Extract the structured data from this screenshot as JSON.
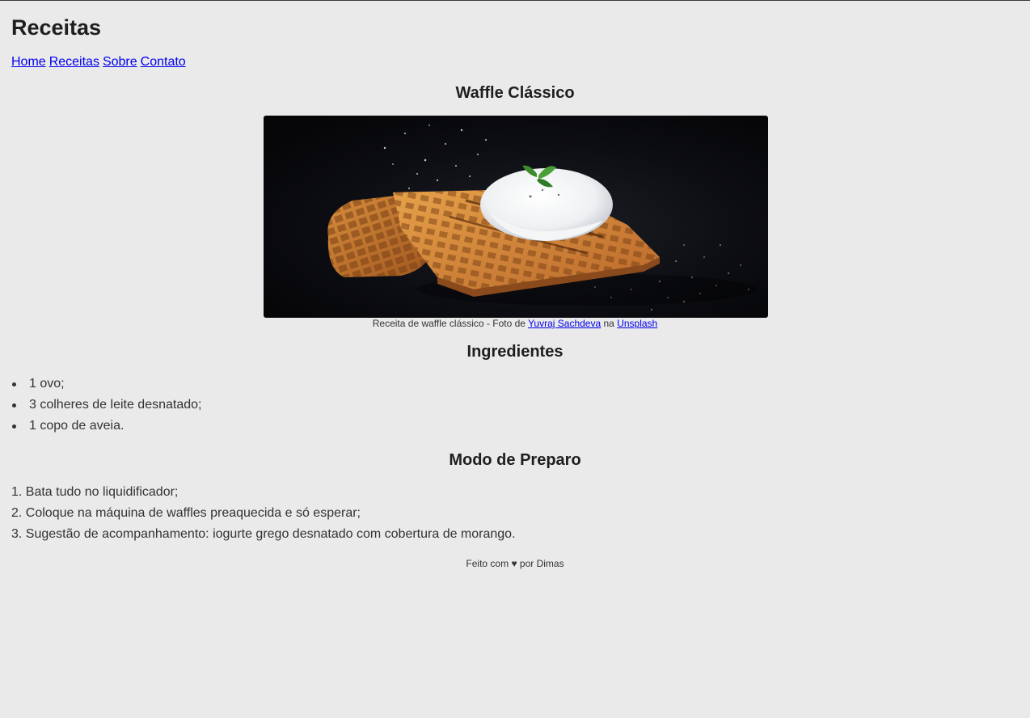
{
  "header": {
    "title": "Receitas",
    "nav": [
      "Home",
      "Receitas",
      "Sobre",
      "Contato"
    ]
  },
  "recipe": {
    "title": "Waffle Clássico",
    "image_alt": "Receita de waffle clássico",
    "caption": {
      "prefix": "Receita de waffle clássico - Foto de",
      "author": "Yuvraj Sachdeva",
      "middle": "na",
      "source": "Unsplash"
    },
    "ingredients_title": "Ingredientes",
    "ingredients": [
      "1 ovo;",
      "3 colheres de leite desnatado;",
      "1 copo de aveia."
    ],
    "steps_title": "Modo de Preparo",
    "steps": [
      "1. Bata tudo no liquidificador;",
      "2. Coloque na máquina de waffles preaquecida e só esperar;",
      "3. Sugestão de acompanhamento: iogurte grego desnatado com cobertura de morango."
    ]
  },
  "footer": {
    "prefix": "Feito com",
    "heart": "♥",
    "suffix": "por Dimas"
  }
}
